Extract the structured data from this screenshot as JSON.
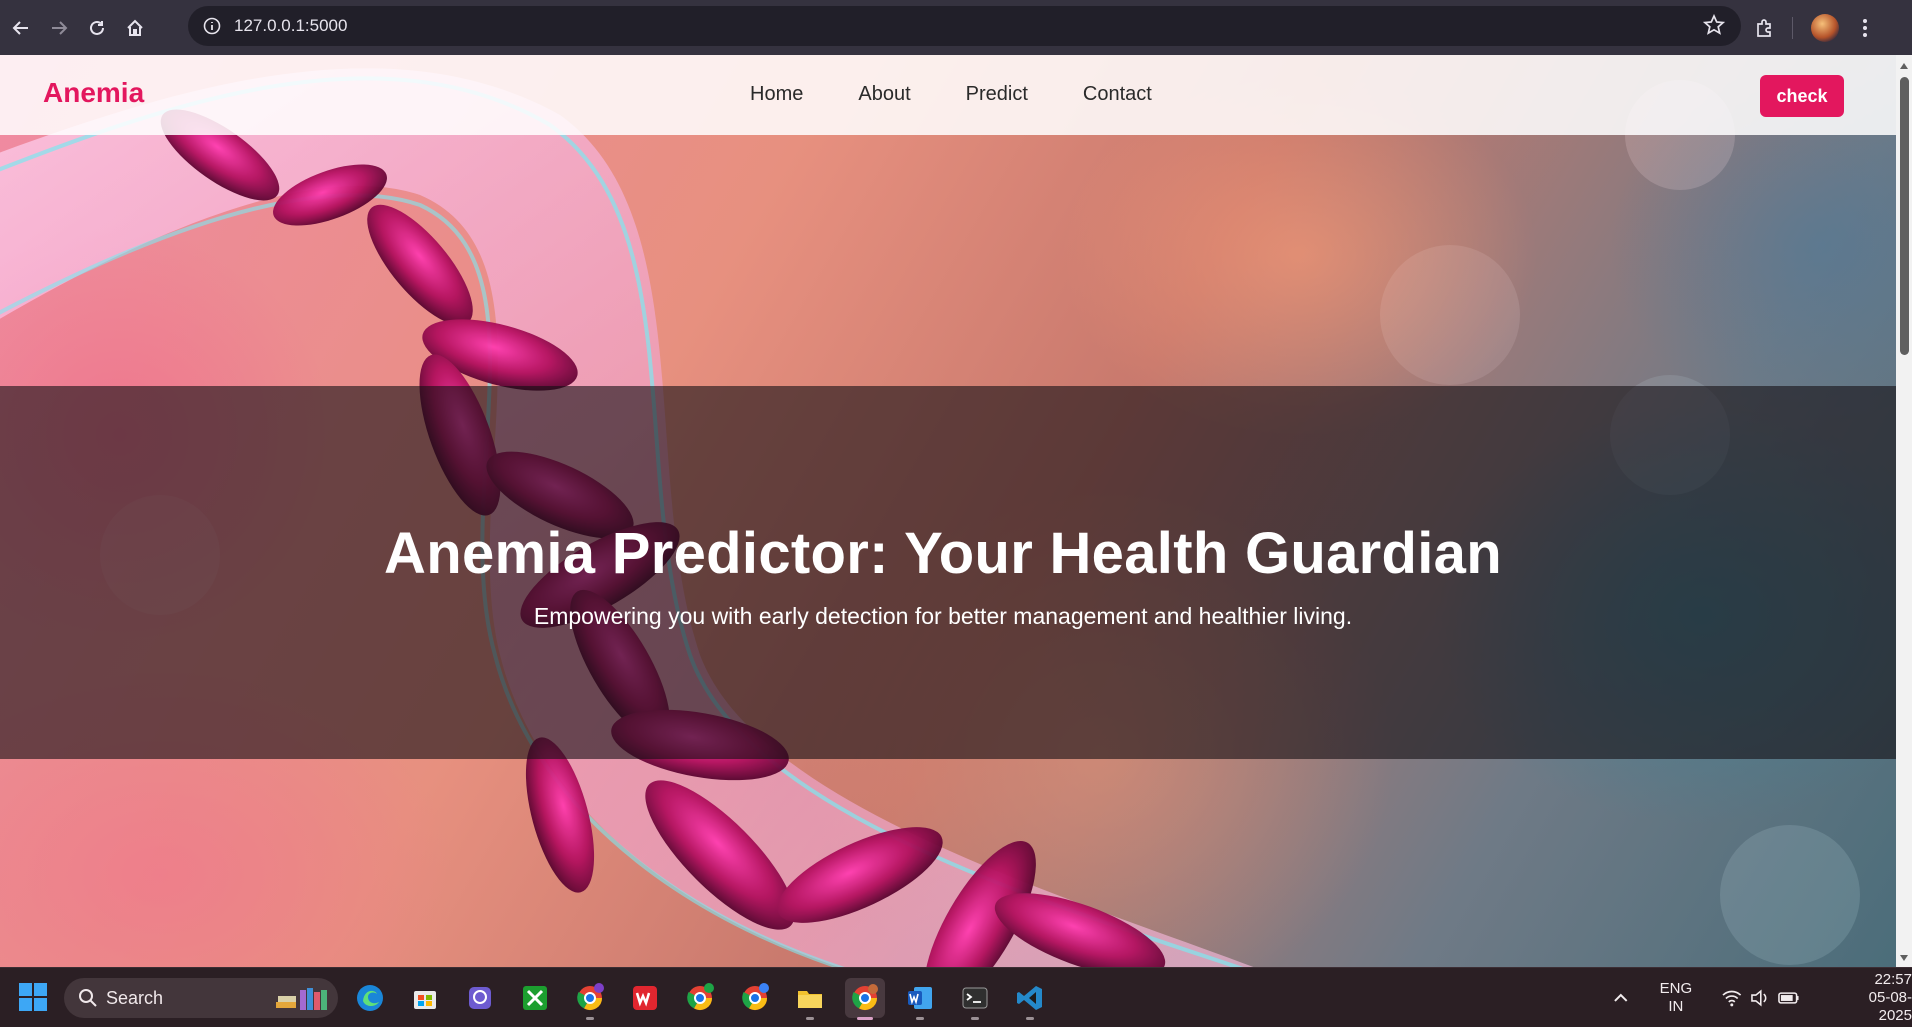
{
  "browser": {
    "url": "127.0.0.1:5000",
    "icons": [
      "back-icon",
      "forward-icon",
      "reload-icon",
      "home-icon",
      "site-info-icon",
      "bookmark-star-icon",
      "extensions-icon",
      "profile-avatar",
      "menu-dots-icon"
    ]
  },
  "site": {
    "brand": "Anemia",
    "nav": [
      {
        "label": "Home"
      },
      {
        "label": "About"
      },
      {
        "label": "Predict"
      },
      {
        "label": "Contact"
      }
    ],
    "cta_label": "check",
    "colors": {
      "accent": "#e3175e"
    }
  },
  "hero": {
    "title": "Anemia Predictor: Your Health Guardian",
    "subtitle": "Empowering you with early detection for better management and healthier living."
  },
  "taskbar": {
    "search_label": "Search",
    "apps": [
      "edge-icon",
      "store-icon",
      "photos-icon",
      "xbox-icon",
      "chrome-profile-v-icon",
      "wps-office-icon",
      "chrome-profile-v2-icon",
      "chrome-icon",
      "file-explorer-icon",
      "chrome-active-icon",
      "word-icon",
      "terminal-icon",
      "vscode-icon"
    ],
    "language_line1": "ENG",
    "language_line2": "IN",
    "time": "22:57",
    "date": "05-08-2025"
  }
}
